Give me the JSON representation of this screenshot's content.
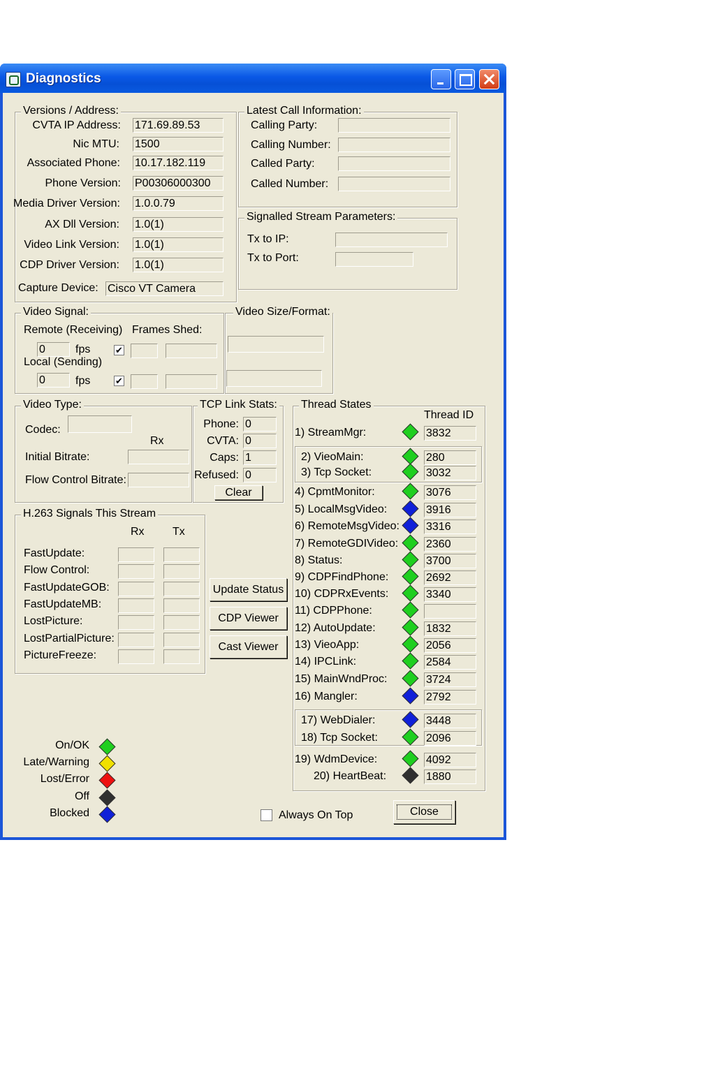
{
  "window": {
    "title": "Diagnostics"
  },
  "versions": {
    "title": "Versions / Address:",
    "rows": [
      {
        "label": "CVTA IP Address:",
        "value": "171.69.89.53"
      },
      {
        "label": "Nic MTU:",
        "value": "1500"
      },
      {
        "label": "Associated Phone:",
        "value": "10.17.182.119"
      },
      {
        "label": "Phone Version:",
        "value": "P00306000300"
      },
      {
        "label": "Media Driver Version:",
        "value": "1.0.0.79"
      },
      {
        "label": "AX Dll Version:",
        "value": "1.0(1)"
      },
      {
        "label": "Video Link Version:",
        "value": "1.0(1)"
      },
      {
        "label": "CDP Driver Version:",
        "value": "1.0(1)"
      }
    ],
    "capture_label": "Capture Device:",
    "capture_value": "Cisco VT Camera"
  },
  "call_info": {
    "title": "Latest Call Information:",
    "rows": [
      {
        "label": "Calling Party:",
        "value": ""
      },
      {
        "label": "Calling Number:",
        "value": ""
      },
      {
        "label": "Called Party:",
        "value": ""
      },
      {
        "label": "Called Number:",
        "value": ""
      }
    ]
  },
  "stream_params": {
    "title": "Signalled Stream Parameters:",
    "tx_ip_label": "Tx to IP:",
    "tx_ip_value": "",
    "tx_port_label": "Tx to Port:",
    "tx_port_value": ""
  },
  "video_signal": {
    "title": "Video Signal:",
    "remote_label": "Remote (Receiving)",
    "frames_shed_label": "Frames Shed:",
    "remote_fps": "0",
    "fps_label": "fps",
    "local_label": "Local (Sending)",
    "local_fps": "0",
    "remote_checked": true,
    "local_checked": true
  },
  "video_size": {
    "title": "Video Size/Format:"
  },
  "video_type": {
    "title": "Video Type:",
    "codec_label": "Codec:",
    "rx_label": "Rx",
    "initial_bitrate_label": "Initial Bitrate:",
    "flow_control_bitrate_label": "Flow Control Bitrate:"
  },
  "tcp_stats": {
    "title": "TCP Link Stats:",
    "rows": [
      {
        "label": "Phone:",
        "value": "0"
      },
      {
        "label": "CVTA:",
        "value": "0"
      },
      {
        "label": "Caps:",
        "value": "1"
      },
      {
        "label": "Refused:",
        "value": "0"
      }
    ],
    "clear_label": "Clear"
  },
  "h263": {
    "title": "H.263 Signals This Stream",
    "rx_label": "Rx",
    "tx_label": "Tx",
    "rows": [
      "FastUpdate:",
      "Flow Control:",
      "FastUpdateGOB:",
      "FastUpdateMB:",
      "LostPicture:",
      "LostPartialPicture:",
      "PictureFreeze:"
    ]
  },
  "actions": {
    "update_status": "Update Status",
    "cdp_viewer": "CDP Viewer",
    "cast_viewer": "Cast Viewer"
  },
  "threads": {
    "title": "Thread States",
    "id_header": "Thread ID",
    "items": [
      {
        "label": "1) StreamMgr:",
        "id": "3832",
        "state": "green"
      },
      {
        "label": "2) VieoMain:",
        "id": "280",
        "state": "green"
      },
      {
        "label": "3) Tcp Socket:",
        "id": "3032",
        "state": "green"
      },
      {
        "label": "4) CpmtMonitor:",
        "id": "3076",
        "state": "green"
      },
      {
        "label": "5) LocalMsgVideo:",
        "id": "3916",
        "state": "blue"
      },
      {
        "label": "6) RemoteMsgVideo:",
        "id": "3316",
        "state": "blue"
      },
      {
        "label": "7) RemoteGDIVideo:",
        "id": "2360",
        "state": "green"
      },
      {
        "label": "8) Status:",
        "id": "3700",
        "state": "green"
      },
      {
        "label": "9) CDPFindPhone:",
        "id": "2692",
        "state": "green"
      },
      {
        "label": "10) CDPRxEvents:",
        "id": "3340",
        "state": "green"
      },
      {
        "label": "11) CDPPhone:",
        "id": "",
        "state": "green"
      },
      {
        "label": "12) AutoUpdate:",
        "id": "1832",
        "state": "green"
      },
      {
        "label": "13) VieoApp:",
        "id": "2056",
        "state": "green"
      },
      {
        "label": "14) IPCLink:",
        "id": "2584",
        "state": "green"
      },
      {
        "label": "15) MainWndProc:",
        "id": "3724",
        "state": "green"
      },
      {
        "label": "16) Mangler:",
        "id": "2792",
        "state": "blue"
      },
      {
        "label": "17) WebDialer:",
        "id": "3448",
        "state": "blue"
      },
      {
        "label": "18) Tcp Socket:",
        "id": "2096",
        "state": "green"
      },
      {
        "label": "19) WdmDevice:",
        "id": "4092",
        "state": "green"
      },
      {
        "label": "20) HeartBeat:",
        "id": "1880",
        "state": "black"
      }
    ]
  },
  "legend": [
    {
      "label": "On/OK",
      "color": "green"
    },
    {
      "label": "Late/Warning",
      "color": "yellow"
    },
    {
      "label": "Lost/Error",
      "color": "red"
    },
    {
      "label": "Off",
      "color": "black"
    },
    {
      "label": "Blocked",
      "color": "blue"
    }
  ],
  "colors": {
    "green": "#1fcf1f",
    "blue": "#1020d8",
    "yellow": "#f0e000",
    "red": "#ee1010",
    "black": "#303030"
  },
  "always_on_top": {
    "label": "Always On Top",
    "checked": false
  },
  "close_label": "Close"
}
